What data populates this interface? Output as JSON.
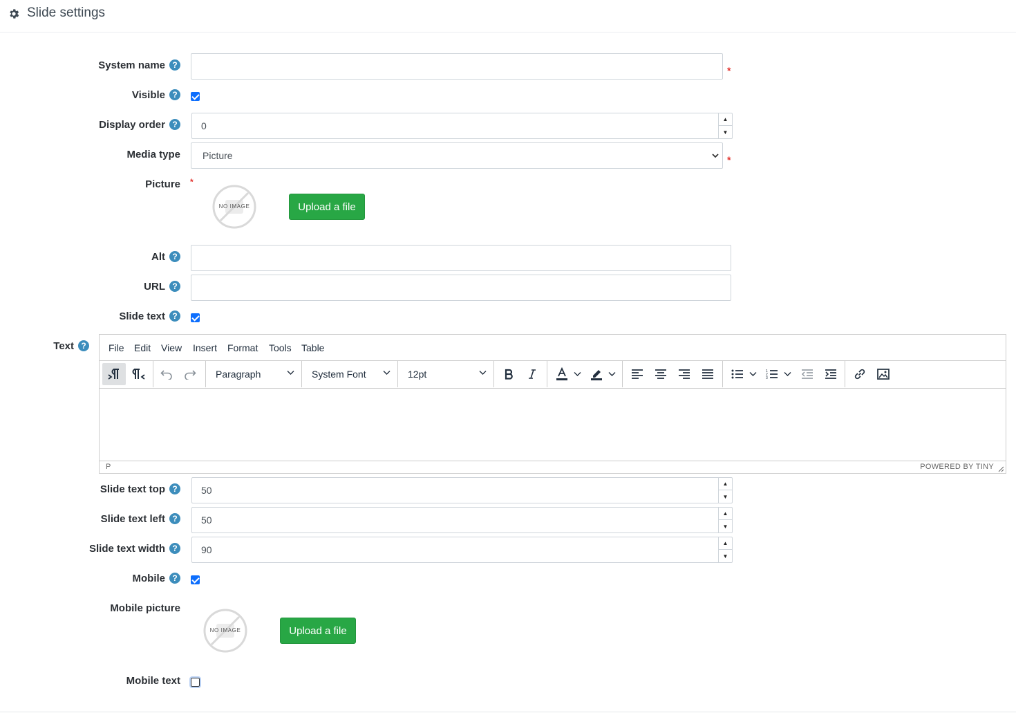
{
  "header": {
    "title": "Slide settings",
    "icon": "gear-icon"
  },
  "form": {
    "system_name": {
      "label": "System name",
      "value": ""
    },
    "visible": {
      "label": "Visible",
      "checked": true
    },
    "display_order": {
      "label": "Display order",
      "value": "0"
    },
    "media_type": {
      "label": "Media type",
      "value": "Picture"
    },
    "picture": {
      "label": "Picture",
      "no_image": "NO IMAGE",
      "upload_label": "Upload a file"
    },
    "alt": {
      "label": "Alt",
      "value": ""
    },
    "url": {
      "label": "URL",
      "value": ""
    },
    "slide_text": {
      "label": "Slide text",
      "checked": true
    },
    "text": {
      "label": "Text"
    },
    "slide_text_top": {
      "label": "Slide text top",
      "value": "50"
    },
    "slide_text_left": {
      "label": "Slide text left",
      "value": "50"
    },
    "slide_text_width": {
      "label": "Slide text width",
      "value": "90"
    },
    "mobile": {
      "label": "Mobile",
      "checked": true
    },
    "mobile_picture": {
      "label": "Mobile picture",
      "no_image": "NO IMAGE",
      "upload_label": "Upload a file"
    },
    "mobile_text": {
      "label": "Mobile text",
      "checked": false
    },
    "required_mark": "*",
    "help_glyph": "?"
  },
  "editor": {
    "menu": [
      "File",
      "Edit",
      "View",
      "Insert",
      "Format",
      "Tools",
      "Table"
    ],
    "block_format": "Paragraph",
    "font_family": "System Font",
    "font_size": "12pt",
    "status_path": "P",
    "branding": "POWERED BY TINY"
  },
  "colors": {
    "accent_blue": "#3c8dbc",
    "upload_green": "#28a745",
    "required_red": "#e3342f",
    "checkbox_blue": "#0d6efd"
  }
}
